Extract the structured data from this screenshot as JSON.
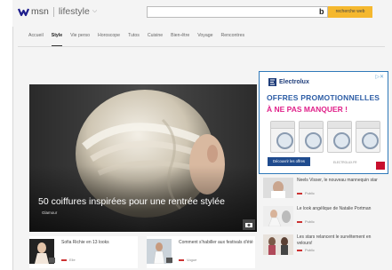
{
  "header": {
    "brand": "msn",
    "section": "lifestyle",
    "search_placeholder": "",
    "bing_label": "b",
    "search_button": "recherche web"
  },
  "nav": {
    "items": [
      "Accueil",
      "Style",
      "Vie perso",
      "Horoscope",
      "Tutos",
      "Cuisine",
      "Bien-être",
      "Voyage",
      "Rencontres"
    ],
    "active": "Style"
  },
  "hero": {
    "title": "50 coiffures inspirées pour une rentrée stylée",
    "source": "Glamour"
  },
  "ad": {
    "brand": "Electrolux",
    "line1": "OFFRES PROMOTIONNELLES",
    "line2": "À NE PAS MANQUER !",
    "cta": "Découvrir les offres",
    "small": "ELECTROLUX.FR",
    "close": "▷✕",
    "colors": {
      "border": "#2f79b9",
      "blue": "#2e5ea6",
      "pink": "#e0218a"
    }
  },
  "side_stories": [
    {
      "title": "Neels Visser, le nouveau mannequin star",
      "source": "Public"
    },
    {
      "title": "Le look angélique de Natalie Portman",
      "source": "Public"
    },
    {
      "title": "Les stars relancent le survêtement en velours!",
      "source": "Public"
    }
  ],
  "bottom_stories": [
    {
      "title": "Sofia Richie en 13 looks",
      "source": "Elle"
    },
    {
      "title": "Comment s'habiller aux festivals d'été",
      "source": "Vogue"
    }
  ]
}
